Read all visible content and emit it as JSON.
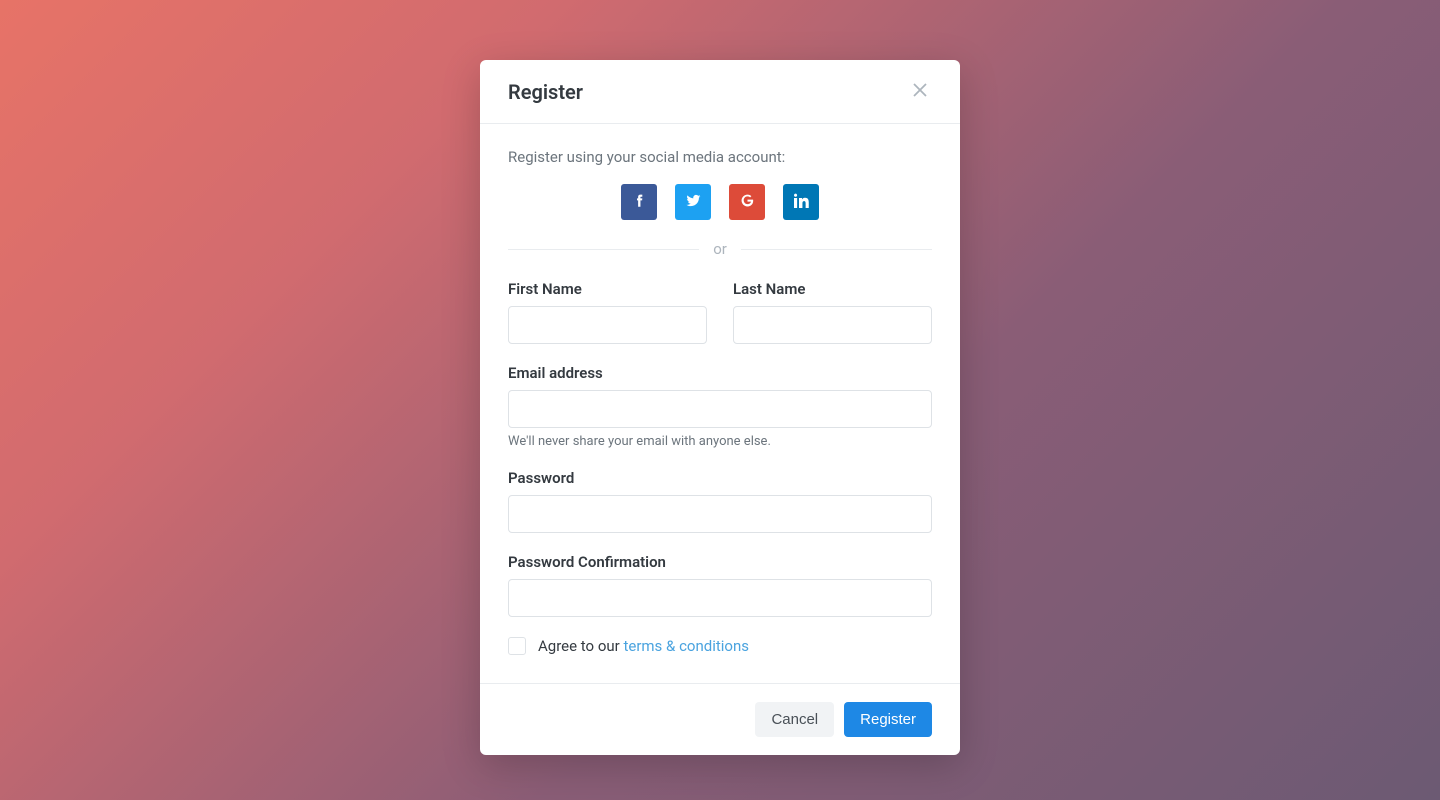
{
  "modal": {
    "title": "Register",
    "social_prompt": "Register using your social media account:",
    "divider": "or",
    "labels": {
      "first_name": "First Name",
      "last_name": "Last Name",
      "email": "Email address",
      "password": "Password",
      "password_confirm": "Password Confirmation"
    },
    "email_help": "We'll never share your email with anyone else.",
    "terms_prefix": "Agree to our ",
    "terms_link": "terms & conditions",
    "values": {
      "first_name": "",
      "last_name": "",
      "email": "",
      "password": "",
      "password_confirm": ""
    },
    "footer": {
      "cancel": "Cancel",
      "submit": "Register"
    }
  }
}
